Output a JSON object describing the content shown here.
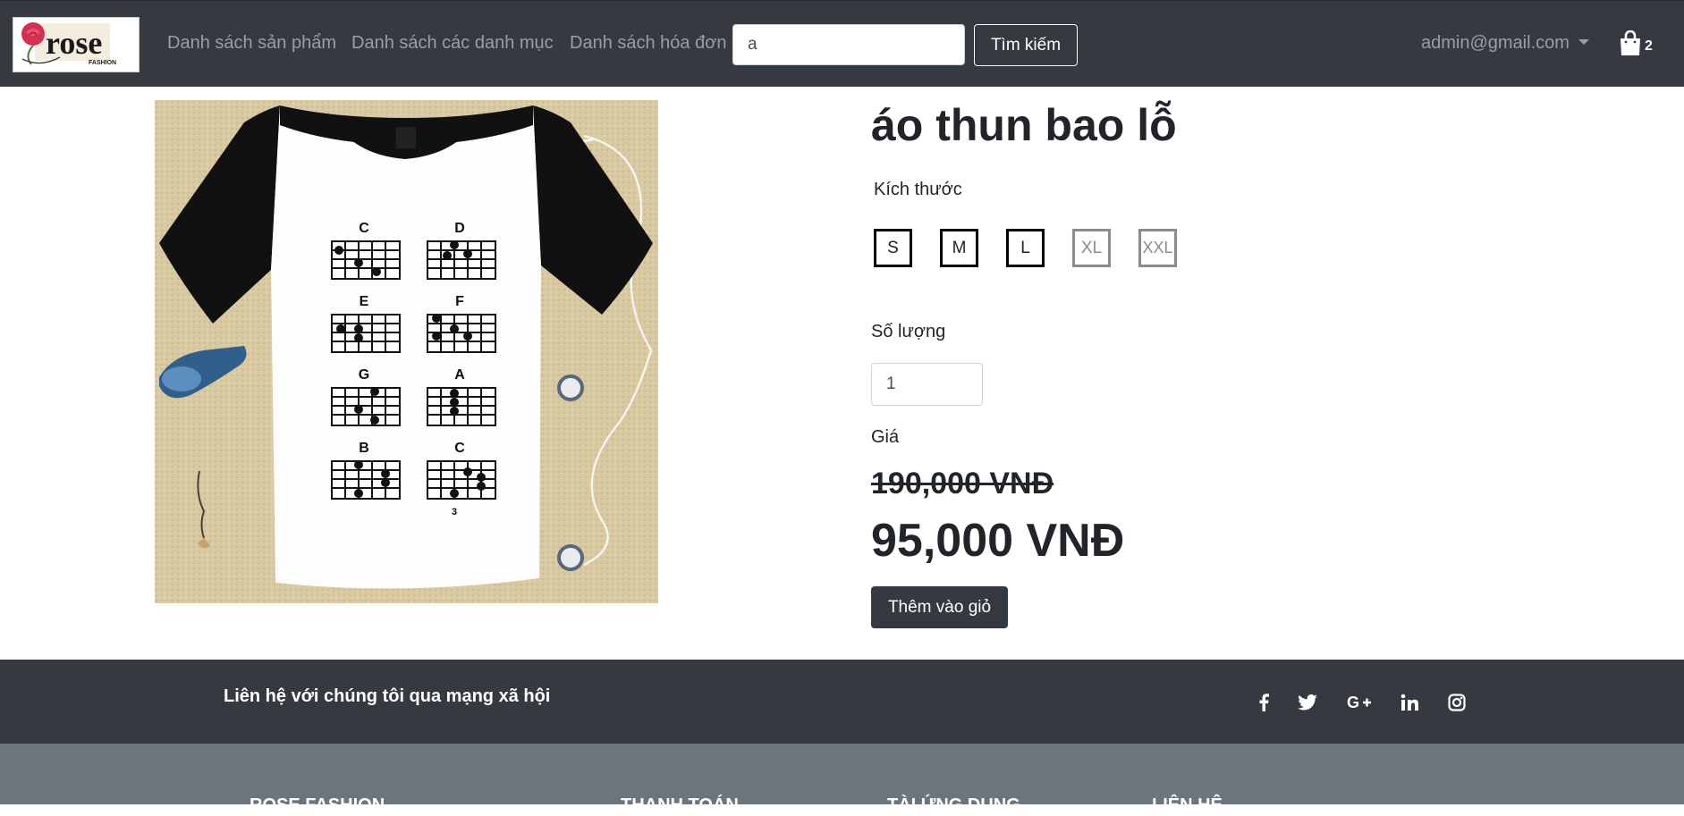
{
  "brand": {
    "logo_text": "rose",
    "logo_subtext": "FASHION"
  },
  "nav": {
    "links": [
      "Danh sách sản phẩm",
      "Danh sách các danh mục",
      "Danh sách hóa đơn"
    ],
    "search_value": "a",
    "search_button": "Tìm kiếm",
    "user_email": "admin@gmail.com",
    "cart_count": "2"
  },
  "product": {
    "title": "áo thun bao lỗ",
    "size_label": "Kích thước",
    "sizes": [
      {
        "label": "S",
        "available": true
      },
      {
        "label": "M",
        "available": true
      },
      {
        "label": "L",
        "available": true
      },
      {
        "label": "XL",
        "available": false
      },
      {
        "label": "XXL",
        "available": false
      }
    ],
    "quantity_label": "Số lượng",
    "quantity_value": "1",
    "price_label": "Giá",
    "old_price": "190,000 VNĐ",
    "new_price": "95,000 VNĐ",
    "add_to_cart": "Thêm vào giỏ",
    "shirt_chords": [
      "C",
      "D",
      "E",
      "F",
      "G",
      "A",
      "B",
      "C"
    ],
    "fret_marker": "3"
  },
  "footer": {
    "social_text": "Liên hệ với chúng tôi qua mạng xã hội",
    "social_icons": [
      "facebook-icon",
      "twitter-icon",
      "google-plus-icon",
      "linkedin-icon",
      "instagram-icon"
    ],
    "headings": [
      "ROSE FASHION",
      "THANH TOÁN",
      "TÀI ỨNG DỤNG",
      "LIÊN HỆ"
    ]
  },
  "colors": {
    "navbar": "#343a40",
    "footer_secondary": "#6c757d",
    "logo_accent": "#d62f4f"
  }
}
